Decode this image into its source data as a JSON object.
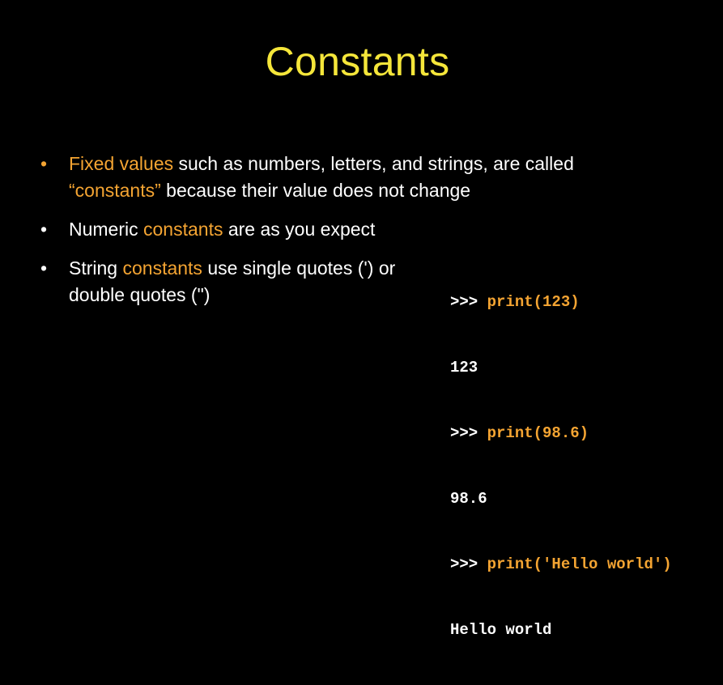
{
  "slide": {
    "title": "Constants",
    "bullets": [
      {
        "highlight": "Fixed values",
        "text": " such as numbers, letters, and strings, are called ",
        "highlight2": "“constants”",
        "text2": " because their value does not change"
      },
      {
        "text": "Numeric ",
        "highlight": "constants",
        "text2": " are as you expect"
      },
      {
        "text": "String ",
        "highlight": "constants",
        "text2": " use single quotes (') or double quotes (\")"
      }
    ],
    "code": [
      {
        "prompt": ">>> ",
        "code": "print(123)"
      },
      {
        "output": "123"
      },
      {
        "prompt": ">>> ",
        "code": "print(98.6)"
      },
      {
        "output": "98.6"
      },
      {
        "prompt": ">>> ",
        "code": "print('Hello world')"
      },
      {
        "output": "Hello world"
      }
    ],
    "colors": {
      "background": "#000000",
      "title": "#f5e63a",
      "highlight": "#f4a432",
      "text": "#ffffff"
    },
    "bullet_glyph": "•"
  }
}
